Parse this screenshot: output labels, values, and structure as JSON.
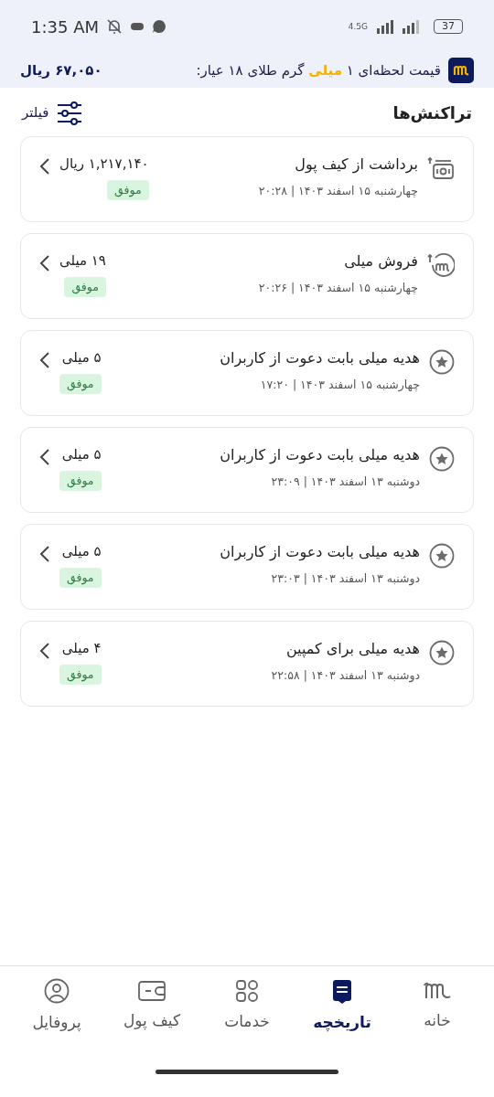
{
  "status_bar": {
    "time": "1:35 AM",
    "network": "4.5G",
    "battery": "37"
  },
  "price_banner": {
    "text_before": "قیمت لحظه‌ای ۱",
    "highlight": "میلی",
    "text_after": "گرم طلای ۱۸ عیار:",
    "price": "۶۷,۰۵۰ ریال"
  },
  "header": {
    "title": "تراکنش‌ها",
    "filter": "فیلتر"
  },
  "transactions": [
    {
      "kind": "withdraw",
      "title": "برداشت از کیف پول",
      "date": "چهارشنبه ۱۵ اسفند ۱۴۰۳ | ۲۰:۲۸",
      "amount": "۱,۲۱۷,۱۴۰ ریال",
      "status": "موفق"
    },
    {
      "kind": "sell",
      "title": "فروش میلی",
      "date": "چهارشنبه ۱۵ اسفند ۱۴۰۳ | ۲۰:۲۶",
      "amount": "۱۹ میلی",
      "status": "موفق"
    },
    {
      "kind": "gift",
      "title": "هدیه میلی بابت دعوت از کاربران",
      "date": "چهارشنبه ۱۵ اسفند ۱۴۰۳ | ۱۷:۲۰",
      "amount": "۵ میلی",
      "status": "موفق"
    },
    {
      "kind": "gift",
      "title": "هدیه میلی بابت دعوت از کاربران",
      "date": "دوشنبه ۱۳ اسفند ۱۴۰۳ | ۲۳:۰۹",
      "amount": "۵ میلی",
      "status": "موفق"
    },
    {
      "kind": "gift",
      "title": "هدیه میلی بابت دعوت از کاربران",
      "date": "دوشنبه ۱۳ اسفند ۱۴۰۳ | ۲۳:۰۳",
      "amount": "۵ میلی",
      "status": "موفق"
    },
    {
      "kind": "gift",
      "title": "هدیه میلی برای کمپین",
      "date": "دوشنبه ۱۳ اسفند ۱۴۰۳ | ۲۲:۵۸",
      "amount": "۴ میلی",
      "status": "موفق"
    }
  ],
  "bottom_nav": [
    {
      "kind": "home",
      "label": "خانه",
      "selected": false
    },
    {
      "kind": "history",
      "label": "تاریخچه",
      "selected": true
    },
    {
      "kind": "services",
      "label": "خدمات",
      "selected": false
    },
    {
      "kind": "wallet",
      "label": "کیف پول",
      "selected": false
    },
    {
      "kind": "profile",
      "label": "پروفایل",
      "selected": false
    }
  ]
}
